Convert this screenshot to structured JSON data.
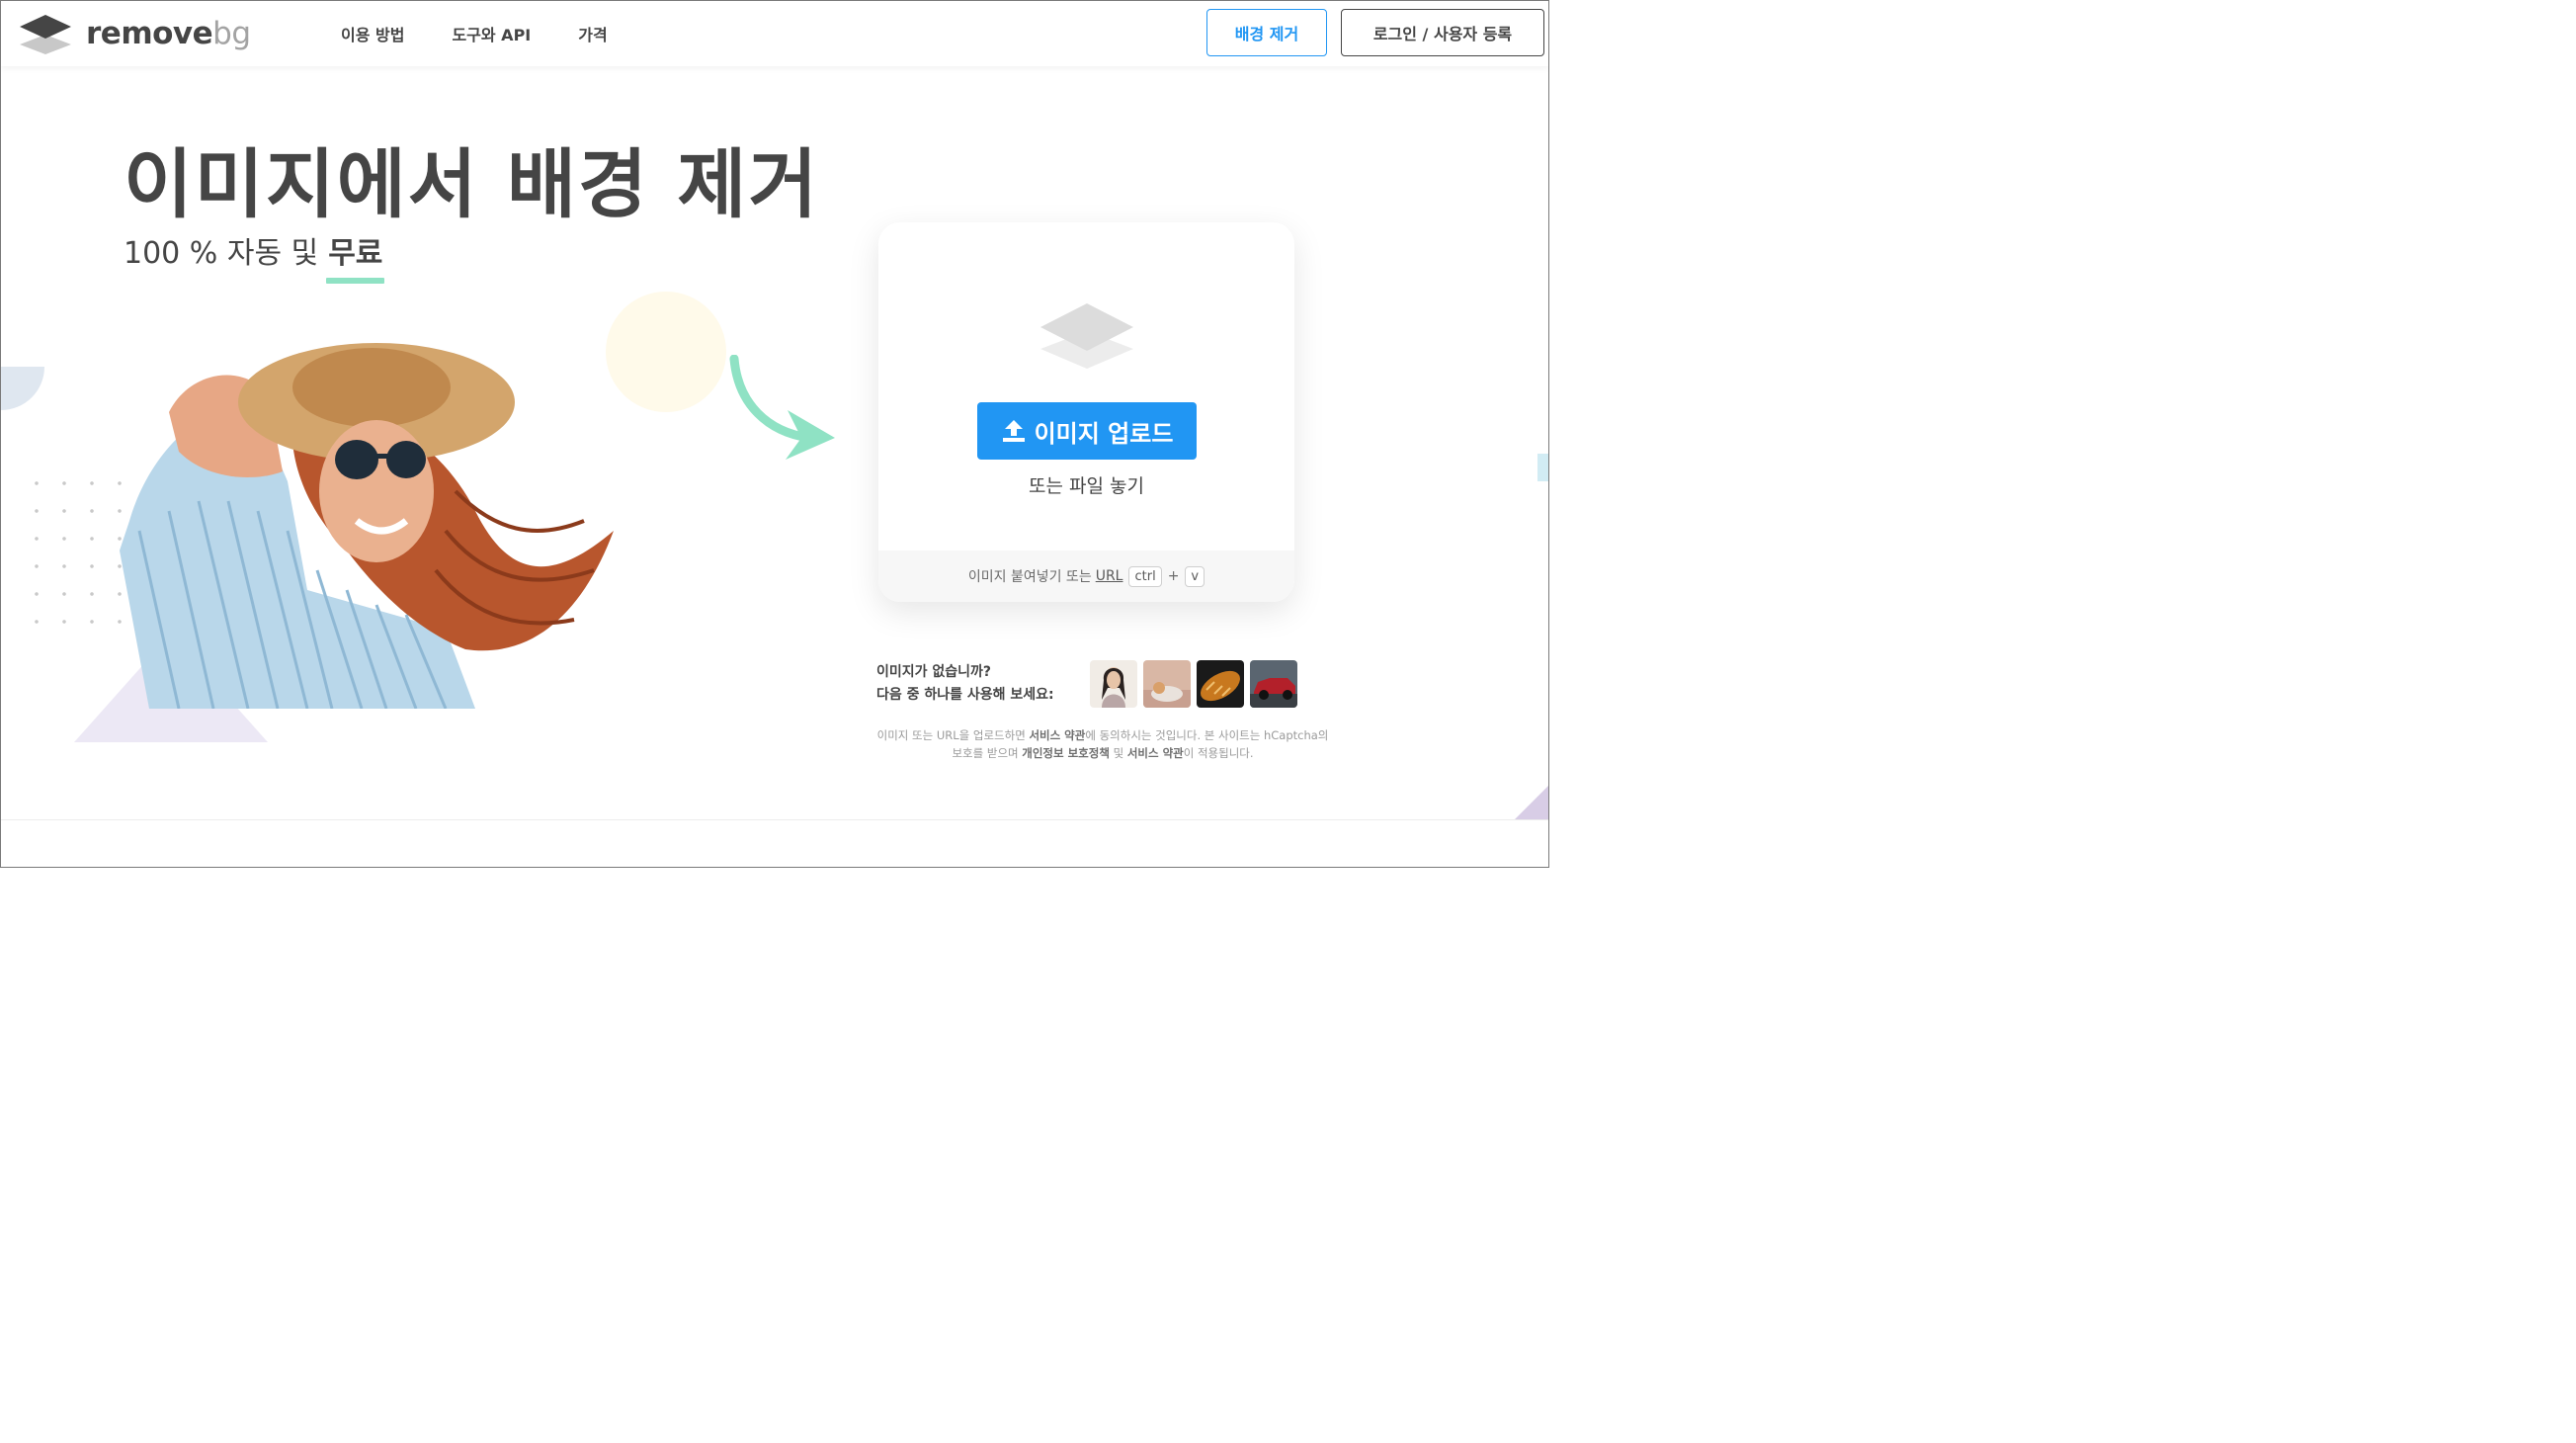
{
  "header": {
    "logo": {
      "text_a": "remove",
      "text_b": "bg"
    },
    "nav": [
      "이용 방법",
      "도구와 API",
      "가격"
    ],
    "remove_bg_button": "배경 제거",
    "login_button": "로그인 / 사용자 등록"
  },
  "hero": {
    "title": "이미지에서 배경 제거",
    "subtitle_prefix": "100 % 자동 및",
    "subtitle_free": "무료"
  },
  "upload_card": {
    "upload_button": "이미지 업로드",
    "drop_text": "또는 파일 놓기",
    "paste_text": "이미지 붙여넣기 또는",
    "paste_url": "URL",
    "key_ctrl": "ctrl",
    "key_plus": "+",
    "key_v": "v"
  },
  "samples": {
    "line1": "이미지가 없습니까?",
    "line2": "다음 중 하나를 사용해 보세요:",
    "items": [
      "woman-portrait",
      "cat",
      "bread",
      "car"
    ]
  },
  "terms": {
    "p1": "이미지 또는 URL을 업로드하면 ",
    "b1": "서비스 약관",
    "p2": "에 동의하시는 것입니다. 본 사이트는 hCaptcha의 보호를 받으며 ",
    "b2": "개인정보 보호정책",
    "p3": " 및 ",
    "b3": "서비스 약관",
    "p4": "이 적용됩니다."
  },
  "colors": {
    "accent": "#2196f3",
    "text": "#454545",
    "underline_green": "#8fe2c4",
    "arrow_green": "#8fe2c4"
  },
  "icons": [
    "logo-layers-icon",
    "upload-arrow-icon",
    "layers-placeholder-icon",
    "curved-arrow-icon"
  ]
}
